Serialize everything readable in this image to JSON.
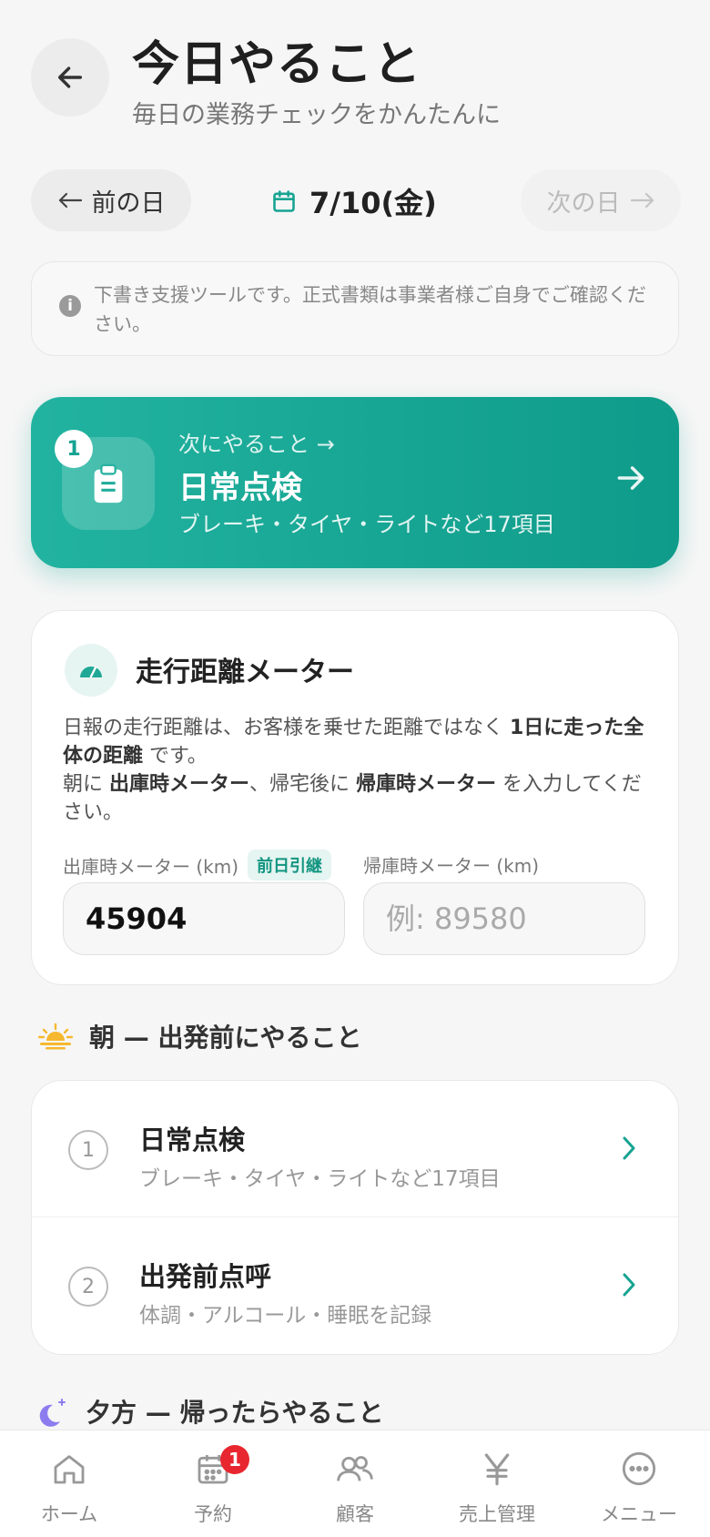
{
  "header": {
    "title": "今日やること",
    "subtitle": "毎日の業務チェックをかんたんに"
  },
  "date_nav": {
    "prev_label": "前の日",
    "current_date": "7/10(金)",
    "next_label": "次の日"
  },
  "notice": {
    "text": "下書き支援ツールです。正式書類は事業者様ご自身でご確認ください。"
  },
  "next_action": {
    "badge": "1",
    "eyebrow": "次にやること →",
    "title": "日常点検",
    "description": "ブレーキ・タイヤ・ライトなど17項目"
  },
  "meter": {
    "title": "走行距離メーター",
    "desc_part1": "日報の走行距離は、お客様を乗せた距離ではなく ",
    "desc_bold1": "1日に走った全体の距離",
    "desc_part2": " です。",
    "desc_part3": "朝に ",
    "desc_bold2": "出庫時メーター",
    "desc_part4": "、帰宅後に ",
    "desc_bold3": "帰庫時メーター",
    "desc_part5": " を入力してください。",
    "out_label": "出庫時メーター (km)",
    "carry_badge": "前日引継",
    "out_value": "45904",
    "in_label": "帰庫時メーター (km)",
    "in_placeholder": "例: 89580"
  },
  "morning": {
    "heading": "朝 — 出発前にやること",
    "tasks": [
      {
        "num": "1",
        "title": "日常点検",
        "sub": "ブレーキ・タイヤ・ライトなど17項目"
      },
      {
        "num": "2",
        "title": "出発前点呼",
        "sub": "体調・アルコール・睡眠を記録"
      }
    ]
  },
  "evening": {
    "heading": "夕方 — 帰ったらやること"
  },
  "bottom_nav": {
    "items": [
      {
        "label": "ホーム",
        "icon": "home-icon"
      },
      {
        "label": "予約",
        "icon": "calendar-icon",
        "badge": "1"
      },
      {
        "label": "顧客",
        "icon": "users-icon"
      },
      {
        "label": "売上管理",
        "icon": "yen-icon"
      },
      {
        "label": "メニュー",
        "icon": "more-icon"
      }
    ]
  },
  "colors": {
    "accent": "#16a392",
    "badge_red": "#e8262f"
  }
}
